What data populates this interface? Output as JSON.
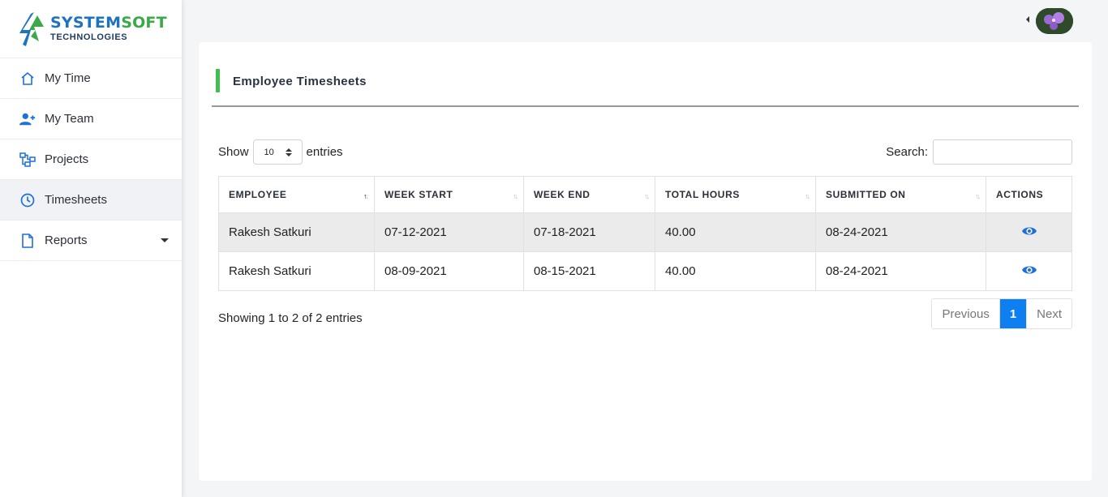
{
  "brand": {
    "name_part1": "SYSTEM",
    "name_part2": "SOFT",
    "subtitle": "TECHNOLOGIES",
    "color_primary": "#1e73be",
    "color_secondary": "#3aa948"
  },
  "sidebar": {
    "items": [
      {
        "label": "My Time",
        "icon": "home-icon"
      },
      {
        "label": "My Team",
        "icon": "user-plus-icon"
      },
      {
        "label": "Projects",
        "icon": "sitemap-icon"
      },
      {
        "label": "Timesheets",
        "icon": "clock-icon",
        "active": true
      },
      {
        "label": "Reports",
        "icon": "file-icon",
        "has_dropdown": true
      }
    ]
  },
  "page": {
    "title": "Employee Timesheets",
    "accent_color": "#3fbf4f"
  },
  "controls": {
    "show_label": "Show",
    "entries_label": "entries",
    "page_length": "10",
    "search_label": "Search:",
    "search_value": ""
  },
  "table": {
    "columns": [
      "EMPLOYEE",
      "WEEK START",
      "WEEK END",
      "TOTAL HOURS",
      "SUBMITTED ON",
      "ACTIONS"
    ],
    "rows": [
      [
        "Rakesh Satkuri",
        "07-12-2021",
        "07-18-2021",
        "40.00",
        "08-24-2021"
      ],
      [
        "Rakesh Satkuri",
        "08-09-2021",
        "08-15-2021",
        "40.00",
        "08-24-2021"
      ]
    ],
    "action_icon": "eye-icon"
  },
  "footer": {
    "info": "Showing 1 to 2 of 2 entries",
    "prev_label": "Previous",
    "page": "1",
    "next_label": "Next"
  }
}
